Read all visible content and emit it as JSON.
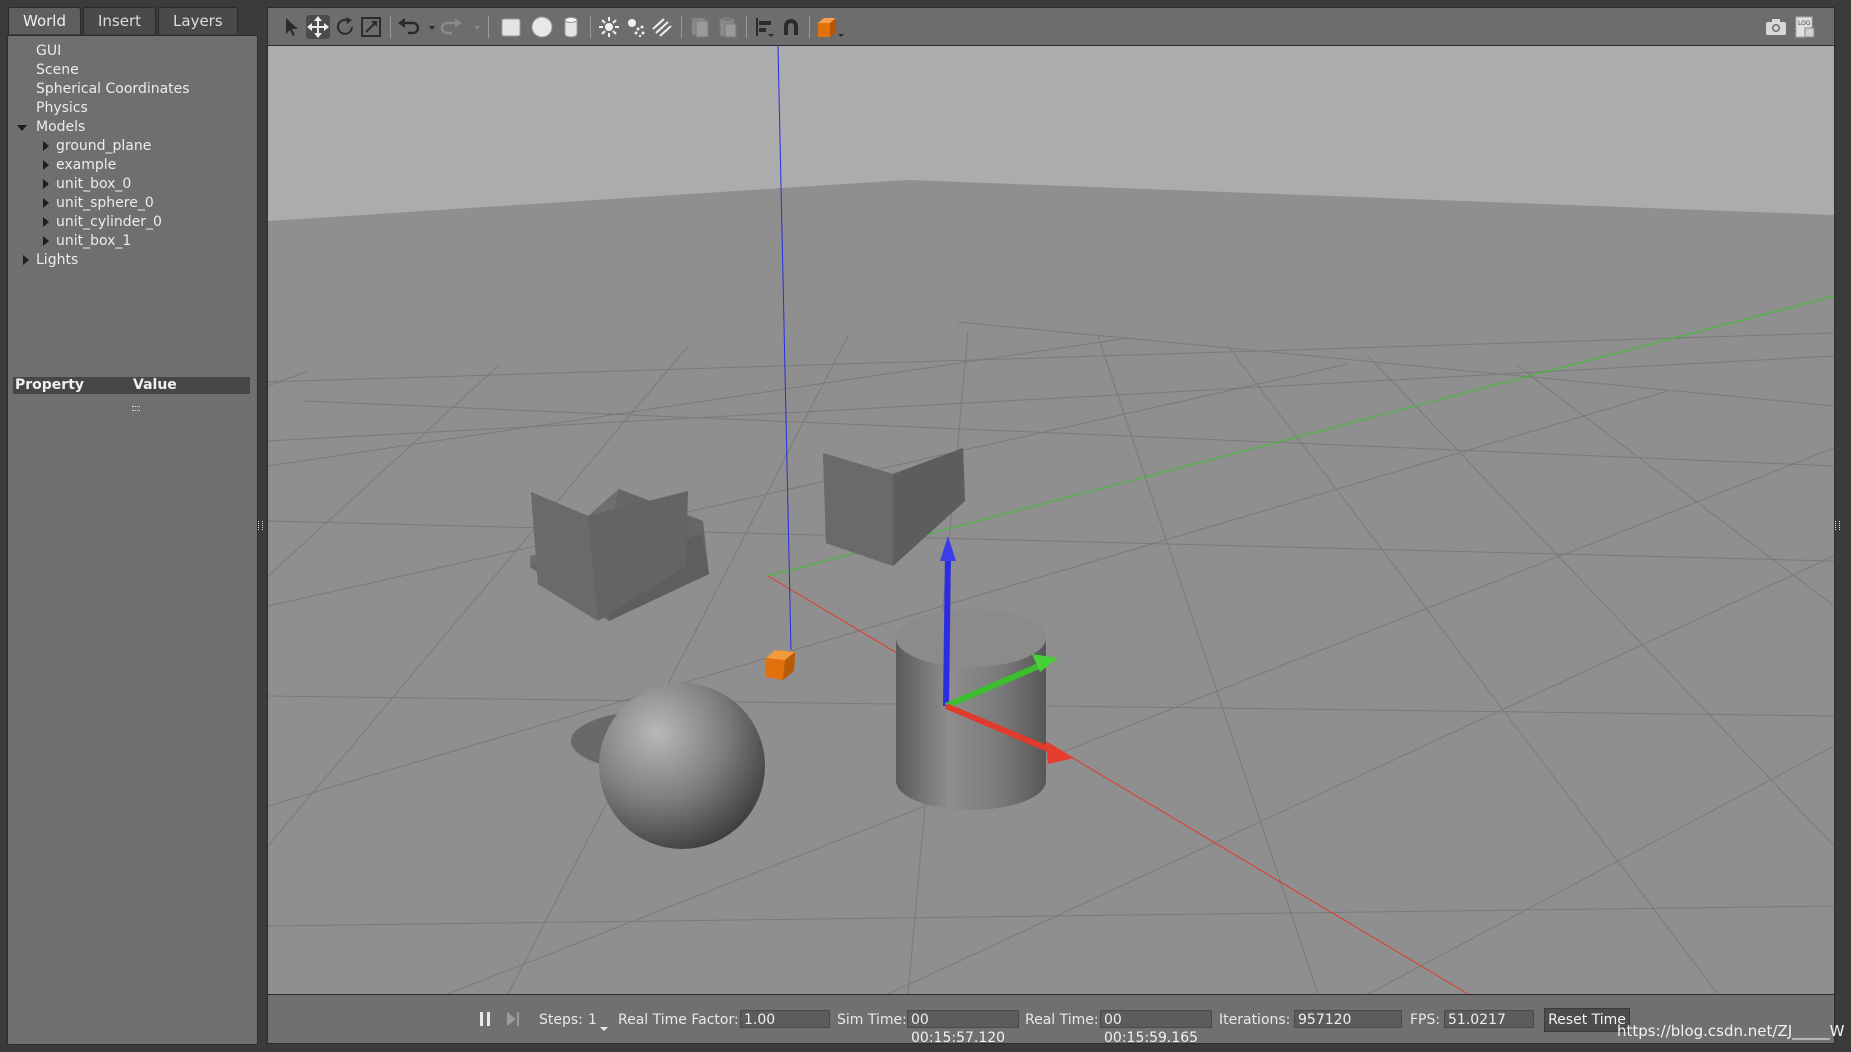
{
  "tabs": [
    {
      "label": "World",
      "active": true
    },
    {
      "label": "Insert",
      "active": false
    },
    {
      "label": "Layers",
      "active": false
    }
  ],
  "tree": {
    "gui": "GUI",
    "scene": "Scene",
    "spherical_coordinates": "Spherical Coordinates",
    "physics": "Physics",
    "models": "Models",
    "model_items": [
      "ground_plane",
      "example",
      "unit_box_0",
      "unit_sphere_0",
      "unit_cylinder_0",
      "unit_box_1"
    ],
    "lights": "Lights"
  },
  "property_table": {
    "property_header": "Property",
    "value_header": "Value"
  },
  "toolbar": {
    "icons": [
      "select-arrow-icon",
      "translate-icon",
      "rotate-icon",
      "scale-icon",
      "undo-icon",
      "undo-history-icon",
      "redo-icon",
      "redo-history-icon",
      "box-icon",
      "sphere-icon",
      "cylinder-icon",
      "point-light-icon",
      "spot-light-icon",
      "directional-light-icon",
      "copy-icon",
      "paste-icon",
      "align-icon",
      "snap-icon",
      "view-angle-icon",
      "screenshot-icon",
      "log-icon"
    ],
    "active_tool": "translate-icon",
    "accent": "#e2700c"
  },
  "bottom_bar": {
    "steps_label": "Steps:",
    "steps_value": "1",
    "real_time_factor_label": "Real Time Factor:",
    "real_time_factor_value": "1.00",
    "sim_time_label": "Sim Time:",
    "sim_time_value": "00 00:15:57.120",
    "real_time_label": "Real Time:",
    "real_time_value": "00 00:15:59.165",
    "iterations_label": "Iterations:",
    "iterations_value": "957120",
    "fps_label": "FPS:",
    "fps_value": "51.0217",
    "reset_time_label": "Reset Time"
  },
  "watermark": "https://blog.csdn.net/ZJ_____W",
  "colors": {
    "x_axis": "#e03a2c",
    "y_axis": "#3bbf2e",
    "z_axis": "#2a2ee0",
    "selected_model": "#e2700c"
  }
}
